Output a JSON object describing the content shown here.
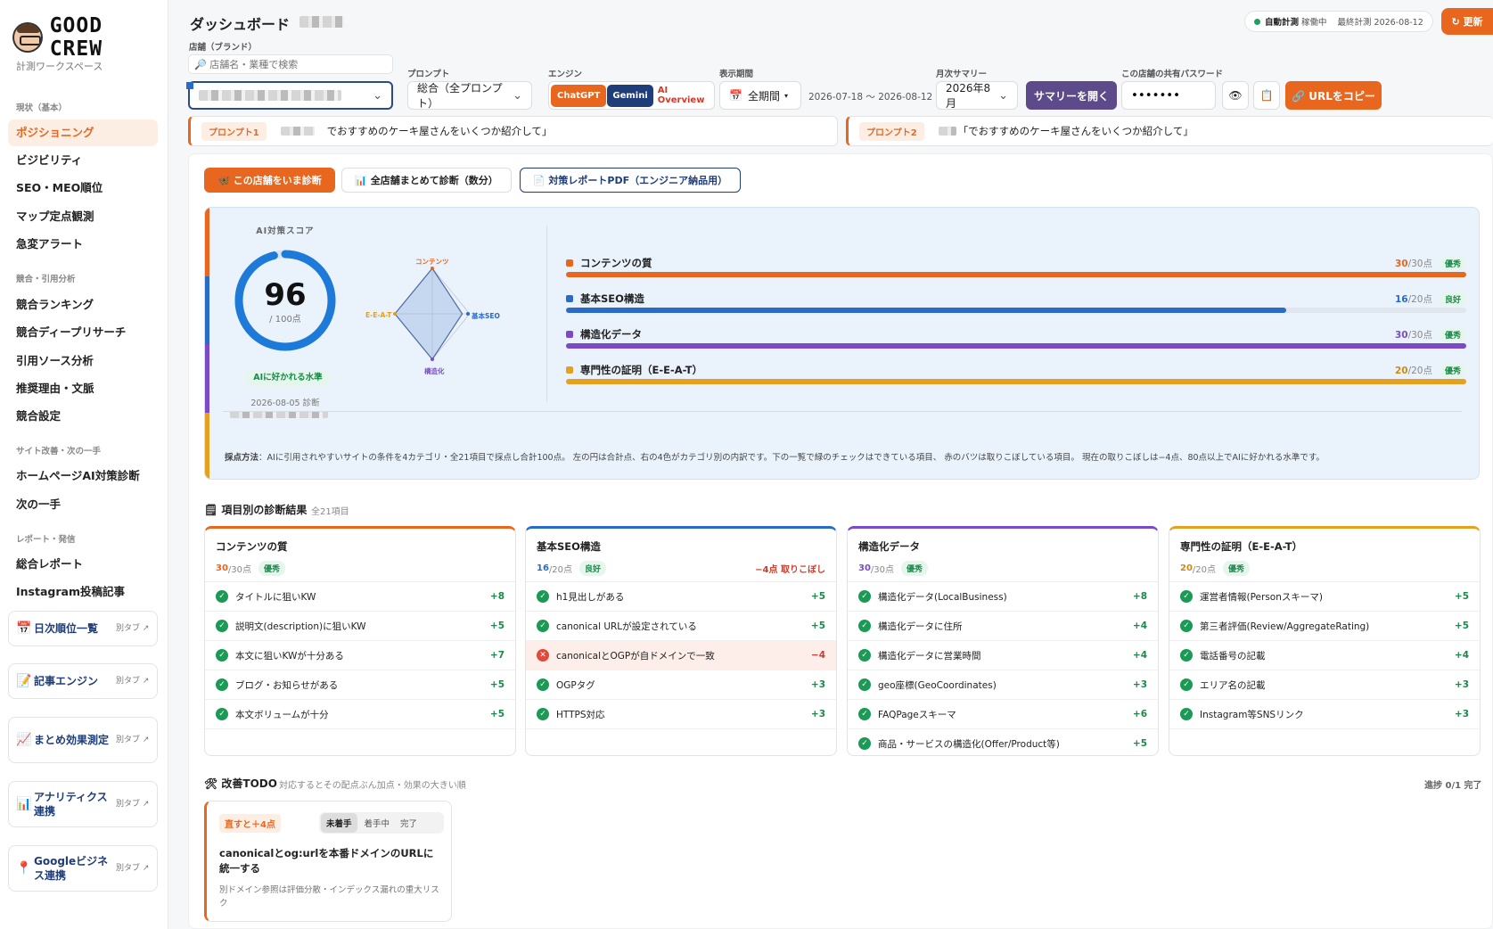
{
  "brand": {
    "name": "GOOD CREW",
    "workspace": "計測ワークスペース"
  },
  "sidebar": {
    "sections": [
      "現状（基本）",
      "競合・引用分析",
      "サイト改善・次の一手",
      "レポート・発信"
    ],
    "items": [
      "ポジショニング",
      "ビジビリティ",
      "SEO・MEO順位",
      "マップ定点観測",
      "急変アラート",
      "競合ランキング",
      "競合ディープリサーチ",
      "引用ソース分析",
      "推奨理由・文脈",
      "競合設定",
      "ホームページAI対策診断",
      "次の一手",
      "総合レポート",
      "Instagram投稿記事"
    ],
    "cards": [
      {
        "label": "日次順位一覧",
        "tag": "別タブ ↗",
        "icon": "calendar-icon"
      },
      {
        "label": "記事エンジン",
        "tag": "別タブ ↗",
        "icon": "memo-icon"
      },
      {
        "label": "まとめ効果測定",
        "tag": "別タブ ↗",
        "icon": "chart-icon"
      },
      {
        "label": "アナリティクス連携",
        "tag": "別タブ ↗",
        "icon": "bar-chart-icon"
      },
      {
        "label": "Googleビジネス連携",
        "tag": "別タブ ↗",
        "icon": "pin-icon"
      }
    ]
  },
  "header": {
    "title": "ダッシュボード",
    "status_live": "自動計測",
    "status_state": "稼働中",
    "status_last": "最終計測 2026-08-12",
    "refresh": "↻ 更新"
  },
  "filters": {
    "store_label": "店舗（ブランド）",
    "search_placeholder": "🔎 店舗名・業種で検索",
    "prompt_label": "プロンプト",
    "prompt_value": "総合（全プロンプト）",
    "engine_label": "エンジン",
    "engines": [
      "ChatGPT",
      "Gemini",
      "AI Overview"
    ],
    "period_label": "表示期間",
    "period_value": "全期間",
    "period_range": "2026-07-18 〜 2026-08-12",
    "summary_label": "月次サマリー",
    "summary_month": "2026年8月",
    "summary_button": "サマリーを開く",
    "password_label": "この店舗の共有パスワード",
    "password_value": "•••••••",
    "copy_button": "🔗 URLをコピー"
  },
  "prompts": [
    {
      "tag": "プロンプト1",
      "text": "でおすすめのケーキ屋さんをいくつか紹介して」"
    },
    {
      "tag": "プロンプト2",
      "text": "「でおすすめのケーキ屋さんをいくつか紹介して」"
    }
  ],
  "actions": {
    "diagnose": "🦋 この店舗をいま診断",
    "all_stores": "📊 全店舗まとめて診断（数分）",
    "pdf": "📄 対策レポートPDF（エンジニア納品用）"
  },
  "score": {
    "label": "AI対策スコア",
    "value": 96,
    "max": "/ 100点",
    "level": "AIに好かれる水準",
    "date": "2026-08-05 診断"
  },
  "radar": {
    "labels": [
      "コンテンツ",
      "基本SEO",
      "構造化",
      "E-E-A-T"
    ]
  },
  "categories": [
    {
      "name": "コンテンツの質",
      "score": 30,
      "max": "/30点",
      "grade": "優秀",
      "color": "#e8661e"
    },
    {
      "name": "基本SEO構造",
      "score": 16,
      "max": "/20点",
      "grade": "良好",
      "color": "#2a6ac8"
    },
    {
      "name": "構造化データ",
      "score": 30,
      "max": "/30点",
      "grade": "優秀",
      "color": "#7a4ac8"
    },
    {
      "name": "専門性の証明（E-E-A-T）",
      "score": 20,
      "max": "/20点",
      "grade": "優秀",
      "color": "#e6a020"
    }
  ],
  "method": {
    "prefix": "採点方法",
    "text": "：AIに引用されやすいサイトの条件を4カテゴリ・全21項目で採点し合計100点。 左の円は合計点、右の4色がカテゴリ別の内訳です。下の一覧で緑のチェックはできている項目、 赤のバツは取りこぼしている項目。 現在の取りこぼしは−4点、80点以上でAIに好かれる水準です。"
  },
  "results": {
    "title": "🗒 項目別の診断結果",
    "count": "全21項目",
    "loss_note": "−4点 取りこぼし"
  },
  "items": [
    [
      [
        "タイトルに狙いKW",
        "+8",
        true
      ],
      [
        "説明文(description)に狙いKW",
        "+5",
        true
      ],
      [
        "本文に狙いKWが十分ある",
        "+7",
        true
      ],
      [
        "ブログ・お知らせがある",
        "+5",
        true
      ],
      [
        "本文ボリュームが十分",
        "+5",
        true
      ]
    ],
    [
      [
        "h1見出しがある",
        "+5",
        true
      ],
      [
        "canonical URLが設定されている",
        "+5",
        true
      ],
      [
        "canonicalとOGPが自ドメインで一致",
        "−4",
        false
      ],
      [
        "OGPタグ",
        "+3",
        true
      ],
      [
        "HTTPS対応",
        "+3",
        true
      ]
    ],
    [
      [
        "構造化データ(LocalBusiness)",
        "+8",
        true
      ],
      [
        "構造化データに住所",
        "+4",
        true
      ],
      [
        "構造化データに営業時間",
        "+4",
        true
      ],
      [
        "geo座標(GeoCoordinates)",
        "+3",
        true
      ],
      [
        "FAQPageスキーマ",
        "+6",
        true
      ],
      [
        "商品・サービスの構造化(Offer/Product等)",
        "+5",
        true
      ]
    ],
    [
      [
        "運営者情報(Personスキーマ)",
        "+5",
        true
      ],
      [
        "第三者評価(Review/AggregateRating)",
        "+5",
        true
      ],
      [
        "電話番号の記載",
        "+4",
        true
      ],
      [
        "エリア名の記載",
        "+3",
        true
      ],
      [
        "Instagram等SNSリンク",
        "+3",
        true
      ]
    ]
  ],
  "todo": {
    "title": "🛠 改善TODO",
    "sub": "対応するとその配点ぶん加点・効果の大きい順",
    "progress": "進捗 0/1 完了",
    "tag": "直すと＋4点",
    "states": [
      "未着手",
      "着手中",
      "完了"
    ],
    "heading": "canonicalとog:urlを本番ドメインのURLに統一する",
    "desc": "別ドメイン参照は評価分散・インデックス漏れの重大リスク"
  }
}
